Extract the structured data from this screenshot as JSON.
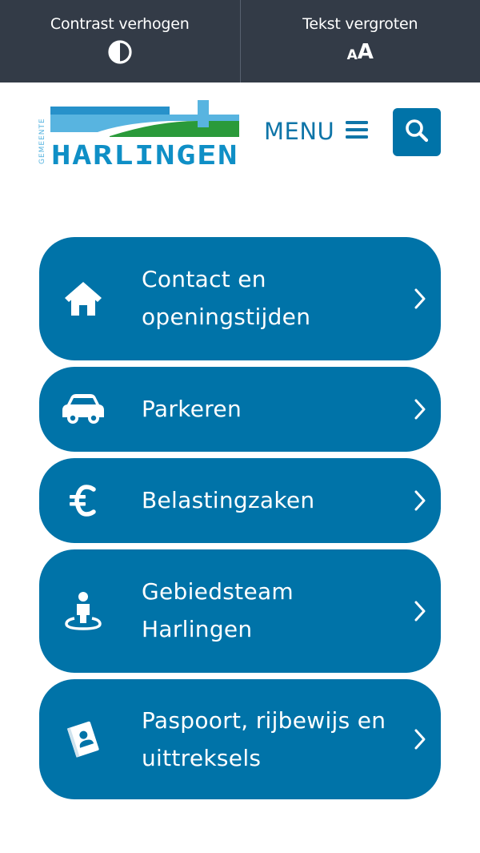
{
  "a11y_bar": {
    "contrast_label": "Contrast verhogen",
    "text_size_label": "Tekst vergroten",
    "text_size_icon_small": "A",
    "text_size_icon_large": "A"
  },
  "header": {
    "logo": {
      "small_text": "GEMEENTE",
      "name": "HARLINGEN",
      "colors": {
        "blue": "#0f8fc6",
        "light_blue": "#58b4e0",
        "green": "#2a9a3a"
      }
    },
    "menu_label": "MENU",
    "search_icon": "search-icon",
    "menu_icon": "hamburger-icon"
  },
  "tiles": [
    {
      "label": "Contact en openingstijden",
      "icon": "home-icon"
    },
    {
      "label": "Parkeren",
      "icon": "car-icon"
    },
    {
      "label": "Belastingzaken",
      "icon": "euro-icon"
    },
    {
      "label": "Gebiedsteam Harlingen",
      "icon": "person-location-icon"
    },
    {
      "label": "Paspoort, rijbewijs en uittreksels",
      "icon": "id-document-icon"
    }
  ],
  "colors": {
    "top_bar": "#333b47",
    "primary_blue": "#0073a8",
    "menu_text": "#0f75a8"
  }
}
